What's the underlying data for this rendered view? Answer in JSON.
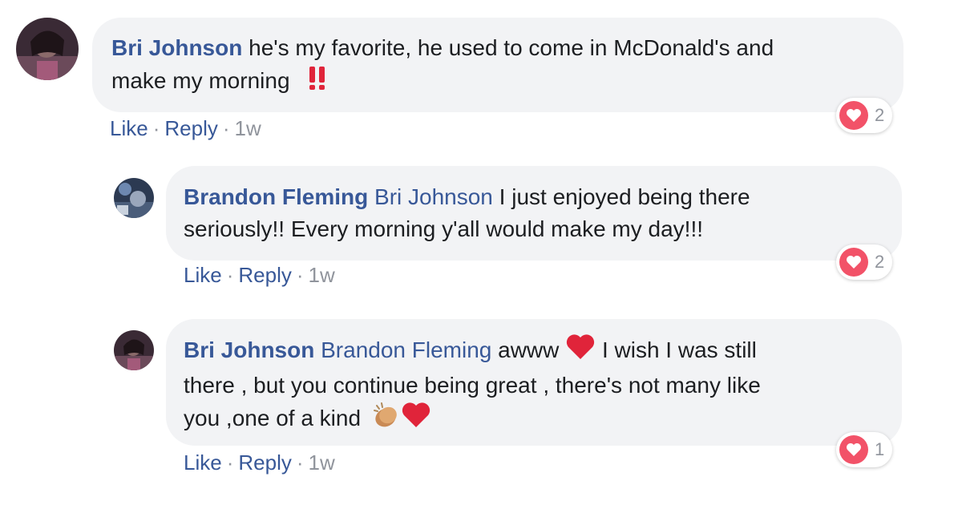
{
  "comments": [
    {
      "author": "Bri Johnson",
      "mention": "",
      "text_line1": "he's my favorite, he used to come in McDonald's and",
      "text_line2": "make my morning",
      "text_line3": "",
      "emoji": [
        "double-exclamation"
      ],
      "actions": {
        "like": "Like",
        "reply": "Reply",
        "time": "1w"
      },
      "reaction": {
        "type": "love",
        "count": "2"
      }
    },
    {
      "author": "Brandon Fleming",
      "mention": "Bri Johnson",
      "text_line1": "I just enjoyed being there",
      "text_line2": "seriously!! Every morning y'all would make my day!!!",
      "text_line3": "",
      "emoji": [],
      "actions": {
        "like": "Like",
        "reply": "Reply",
        "time": "1w"
      },
      "reaction": {
        "type": "love",
        "count": "2"
      }
    },
    {
      "author": "Bri Johnson",
      "mention": "Brandon Fleming",
      "text_line1_a": "awww",
      "text_line1_b": "I wish I was still",
      "text_line2": "there , but you continue being great , there's not many like",
      "text_line3": "you ,one of a kind",
      "emoji": [
        "red-heart",
        "clapping-hands",
        "red-heart"
      ],
      "actions": {
        "like": "Like",
        "reply": "Reply",
        "time": "1w"
      },
      "reaction": {
        "type": "love",
        "count": "1"
      }
    }
  ],
  "separator": "·",
  "colors": {
    "link": "#385898",
    "bubble": "#f2f3f5",
    "meta": "#90949c",
    "love": "#f25268"
  }
}
